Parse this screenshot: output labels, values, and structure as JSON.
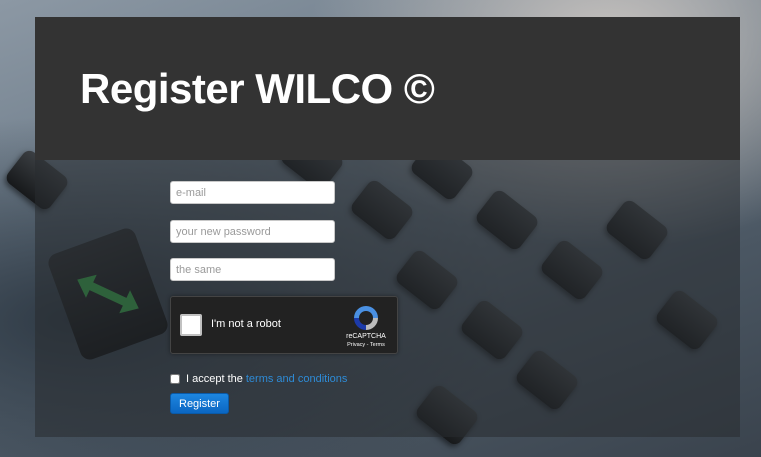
{
  "header": {
    "title": "Register WILCO ©"
  },
  "form": {
    "email_placeholder": "e-mail",
    "password_placeholder": "your new password",
    "confirm_placeholder": "the same",
    "recaptcha": {
      "label": "I'm not a robot",
      "brand": "reCAPTCHA",
      "privacy": "Privacy",
      "separator": " - ",
      "terms": "Terms"
    },
    "accept_prefix": "I accept the",
    "accept_link": "terms and conditions",
    "register_label": "Register"
  },
  "colors": {
    "header_bg": "#333333",
    "link": "#2e8bd6",
    "button": "#0b66c2"
  }
}
